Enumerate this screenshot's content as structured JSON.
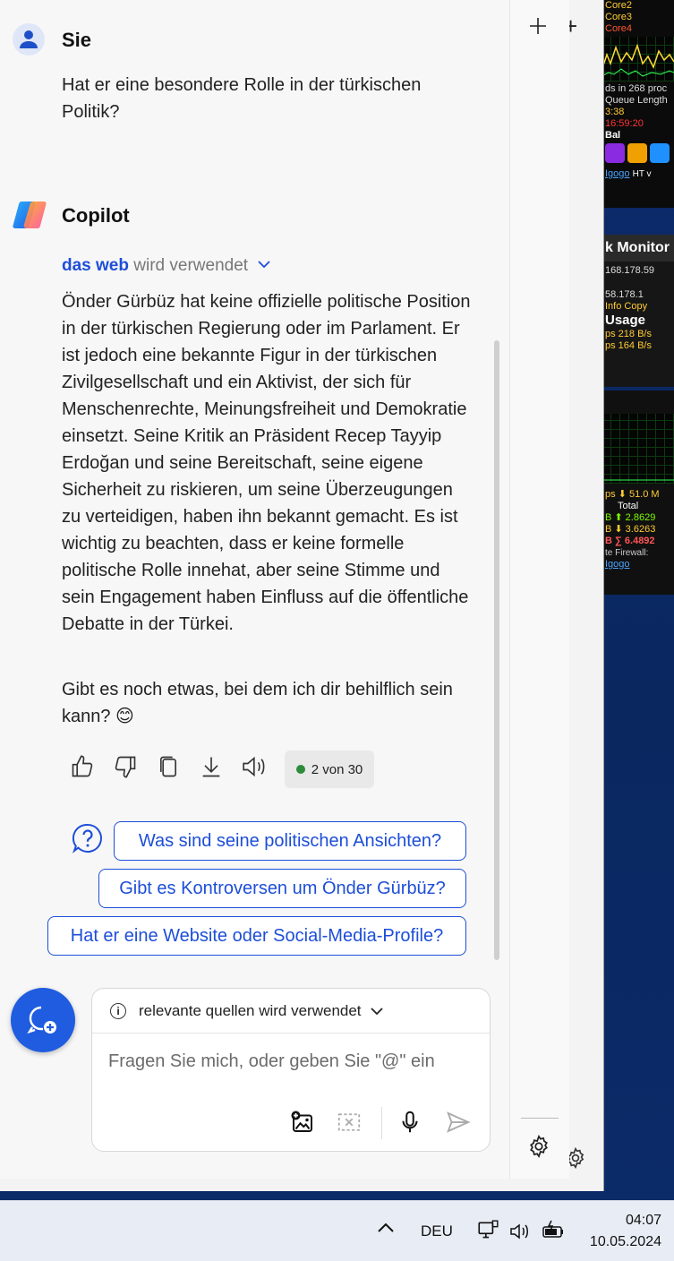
{
  "desktop_widget": {
    "cores": [
      "Core2",
      "Core3",
      "Core4"
    ],
    "proc_line": "ds in 268 proc",
    "queue_line": "Queue Length",
    "time1": "3:38",
    "time2": "16:59:20",
    "bal": "Bal",
    "link1": "Igogo",
    "link1_suffix": "HT v",
    "net_title": "k Monitor",
    "ip1": "168.178.59",
    "ip2": "58.178.1",
    "info": "Info  Copy",
    "usage": "Usage",
    "rate1": "ps   218 B/s",
    "rate2": "ps   164 B/s",
    "down": "ps ⬇ 51.0 M",
    "total": "Total",
    "v1": "B ⬆ 2.8629",
    "v2": "B ⬇ 3.6263",
    "v3": "B ∑ 6.4892",
    "firewall": "te  Firewall:",
    "link2": "Igogo"
  },
  "user": {
    "name": "Sie",
    "message": "Hat er eine besondere Rolle in der türkischen Politik?"
  },
  "copilot": {
    "name": "Copilot",
    "source_link": "das web",
    "source_suffix": "wird verwendet",
    "answer": "Önder Gürbüz hat keine offizielle politische Position in der türkischen Regierung oder im Parlament. Er ist jedoch eine bekannte Figur in der türkischen Zivilgesellschaft und ein Aktivist, der sich für Menschenrechte, Meinungsfreiheit und Demokratie einsetzt. Seine Kritik an Präsident Recep Tayyip Erdoğan und seine Bereitschaft, seine eigene Sicherheit zu riskieren, um seine Überzeugungen zu verteidigen, haben ihn bekannt gemacht. Es ist wichtig zu beachten, dass er keine formelle politische Rolle innehat, aber seine Stimme und sein Engagement haben Einfluss auf die öffentliche Debatte in der Türkei.",
    "followup": "Gibt es noch etwas, bei dem ich dir behilflich sein kann? 😊",
    "counter": "2 von 30"
  },
  "suggestions": [
    "Was sind seine politischen Ansichten?",
    "Gibt es Kontroversen um Önder Gürbüz?",
    "Hat er eine Website oder Social-Media-Profile?"
  ],
  "input": {
    "source_label": "relevante quellen wird verwendet",
    "placeholder": "Fragen Sie mich, oder geben Sie \"@\" ein"
  },
  "taskbar": {
    "language": "DEU",
    "time": "04:07",
    "date": "10.05.2024"
  },
  "colors": {
    "accent": "#1d4ed8",
    "fab": "#1f5ce0"
  }
}
